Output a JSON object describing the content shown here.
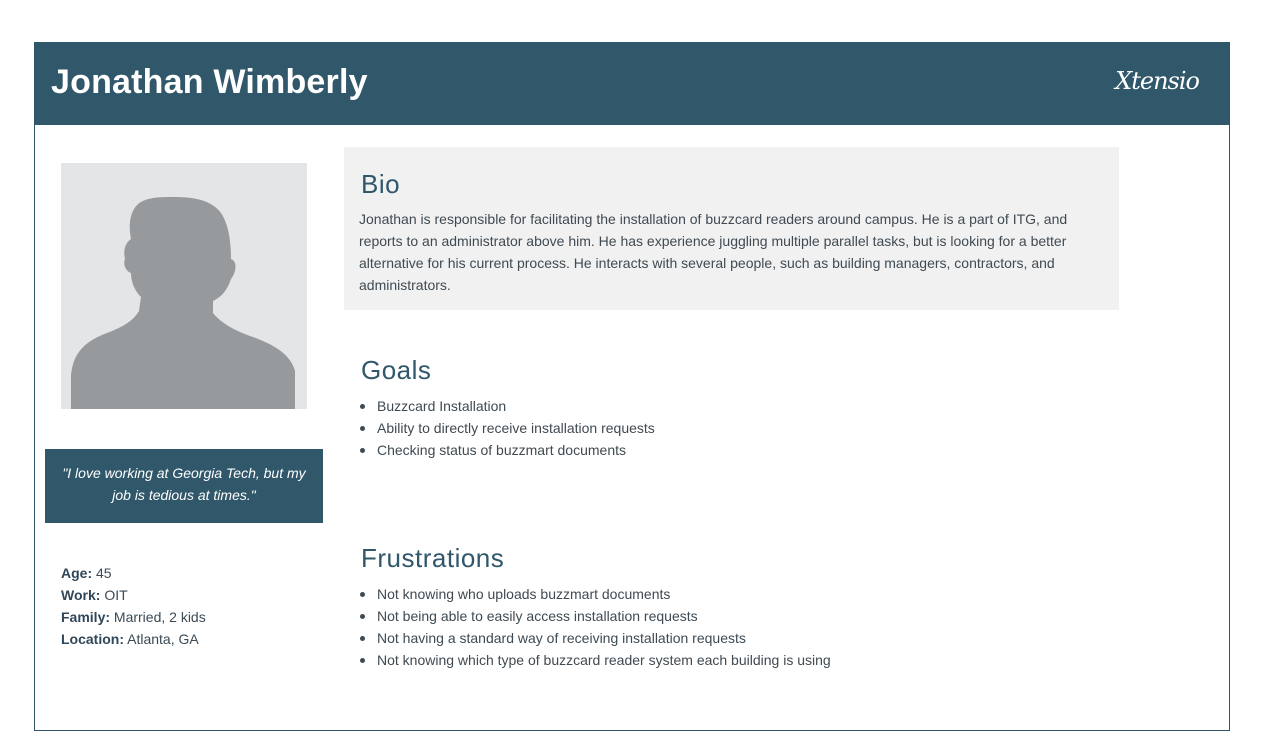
{
  "header": {
    "name": "Jonathan Wimberly",
    "brand": "Xtensio",
    "bg_color": "#30576a"
  },
  "avatar": {
    "icon": "person-silhouette-icon"
  },
  "quote": "\"I love working at Georgia Tech, but my job is tedious at times.\"",
  "facts": [
    {
      "key": "Age:",
      "value": "45"
    },
    {
      "key": "Work:",
      "value": "OIT"
    },
    {
      "key": "Family:",
      "value": "Married, 2 kids"
    },
    {
      "key": "Location:",
      "value": "Atlanta, GA"
    }
  ],
  "bio": {
    "title": "Bio",
    "text": "Jonathan is responsible for facilitating the installation of buzzcard readers around campus. He is a part of ITG, and reports to an administrator above him. He has experience juggling multiple parallel tasks, but is looking for a better alternative for his current process. He interacts with several people, such as building managers, contractors, and administrators."
  },
  "goals": {
    "title": "Goals",
    "items": [
      "Buzzcard Installation",
      "Ability to directly receive installation requests",
      "Checking status of buzzmart documents"
    ]
  },
  "frustrations": {
    "title": "Frustrations",
    "items": [
      "Not knowing who uploads buzzmart documents",
      "Not being able to easily access installation requests",
      "Not having a standard way of receiving installation requests",
      "Not knowing which type of buzzcard reader system each building is using"
    ]
  }
}
